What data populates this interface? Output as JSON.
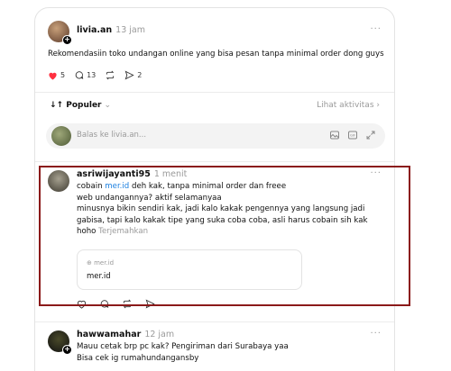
{
  "post": {
    "username": "livia.an",
    "time": "13 jam",
    "more": "···",
    "text": "Rekomendasiin toko undangan online yang bisa pesan tanpa minimal order dong guys",
    "likes": "5",
    "comments": "13",
    "shares": "2"
  },
  "sort": {
    "label": "Populer",
    "activity": "Lihat aktivitas"
  },
  "reply": {
    "placeholder": "Balas ke livia.an..."
  },
  "comments": [
    {
      "username": "asriwijayanti95",
      "time": "1 menit",
      "more": "···",
      "line1_pre": "cobain ",
      "line1_link": "mer.id",
      "line1_post": " deh kak, tanpa minimal order dan freee",
      "line2": "web undangannya? aktif selamanyaa",
      "line3": "minusnya bikin sendiri kak, jadi kalo kakak pengennya yang langsung jadi",
      "line4": "gabisa, tapi kalo kakak tipe yang suka coba coba, asli harus cobain sih kak",
      "line5": "hoho",
      "translate": "Terjemahkan",
      "link_card": {
        "domain": "mer.id",
        "title": "mer.id"
      }
    },
    {
      "username": "hawwamahar",
      "time": "12 jam",
      "more": "···",
      "line1": "Mauu cetak brp pc kak? Pengiriman dari Surabaya yaa",
      "line2": "Bisa cek ig rumahundangansby"
    }
  ],
  "colors": {
    "like": "#ff3040",
    "link": "#1a7fe0",
    "highlight": "#8b1a1a"
  }
}
